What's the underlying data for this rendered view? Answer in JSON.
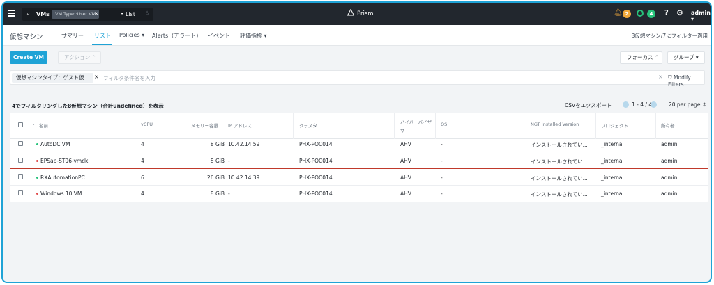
{
  "topbar": {
    "search_entity": "VMs",
    "search_chip": "VM Type::User VM",
    "search_view": "List",
    "brand": "Prism",
    "alerts_count": "2",
    "tasks_count": "4",
    "user": "admin"
  },
  "colors": {
    "accent": "#1fa3d6",
    "on": "#27c27b",
    "off": "#e14c4c",
    "alert": "#f2a93b"
  },
  "subnav": {
    "title": "仮想マシン",
    "tabs": [
      "サマリー",
      "リスト",
      "Policies ▾",
      "Alerts（アラート）",
      "イベント",
      "評価指標 ▾"
    ],
    "active_tab": "リスト",
    "filter_note": "3仮想マシン/7にフィルター適用"
  },
  "actions": {
    "create": "Create VM",
    "action": "アクション ⌃",
    "focus": "フォーカス ⌃",
    "group": "グループ ▾"
  },
  "filter": {
    "chip": "仮想マシンタイプ：ゲスト仮...",
    "placeholder": "フィルタ条件名を入力",
    "modify": "Modify Filters"
  },
  "summary": {
    "text": "4でフィルタリングした8仮想マシン（合計undefined）を表示",
    "csv": "CSVをエクスポート",
    "range": "1 - 4 / 4",
    "per_page": "20 per page ⇕"
  },
  "table": {
    "headers": {
      "name": "名前",
      "vcpu": "vCPU",
      "memory": "メモリー容量",
      "ip": "IP アドレス",
      "cluster": "クラスタ",
      "hypervisor_1": "ハイパーバイザ",
      "hypervisor_2": "ザ",
      "os": "OS",
      "ngt": "NGT Installed Version",
      "project": "プロジェクト",
      "owner": "所有者"
    },
    "rows": [
      {
        "status": "on",
        "name": "AutoDC VM",
        "vcpu": "4",
        "memory": "8 GiB",
        "ip": "10.42.14.59",
        "cluster": "PHX-POC014",
        "hypervisor": "AHV",
        "os": "-",
        "ngt": "インストールされてい...",
        "project": "_internal",
        "owner": "admin"
      },
      {
        "status": "off",
        "name": "EPSap-ST06-vmdk",
        "vcpu": "4",
        "memory": "8 GiB",
        "ip": "-",
        "cluster": "PHX-POC014",
        "hypervisor": "AHV",
        "os": "-",
        "ngt": "インストールされてい...",
        "project": "_internal",
        "owner": "admin"
      },
      {
        "status": "on",
        "name": "RXAutomationPC",
        "vcpu": "6",
        "memory": "26 GiB",
        "ip": "10.42.14.39",
        "cluster": "PHX-POC014",
        "hypervisor": "AHV",
        "os": "-",
        "ngt": "インストールされてい...",
        "project": "_internal",
        "owner": "admin"
      },
      {
        "status": "off",
        "name": "Windows 10 VM",
        "vcpu": "4",
        "memory": "8 GiB",
        "ip": "-",
        "cluster": "PHX-POC014",
        "hypervisor": "AHV",
        "os": "-",
        "ngt": "インストールされてい...",
        "project": "_internal",
        "owner": "admin"
      }
    ]
  }
}
